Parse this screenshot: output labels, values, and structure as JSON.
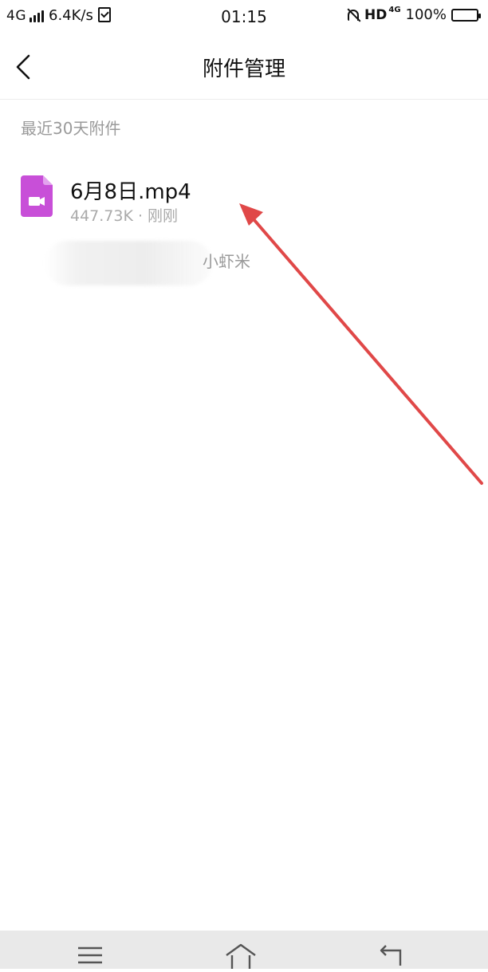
{
  "status_bar": {
    "network": "4G",
    "speed": "6.4K/s",
    "time": "01:15",
    "hd": "HD",
    "hd_network": "4G",
    "battery": "100%",
    "icons": [
      "signal-icon",
      "clipboard-check-icon",
      "bell-off-icon",
      "battery-icon"
    ]
  },
  "header": {
    "title": "附件管理",
    "back_icon": "chevron-left-icon"
  },
  "section": {
    "label": "最近30天附件"
  },
  "file": {
    "name": "6月8日.mp4",
    "meta": "447.73K · 刚刚",
    "icon": "video-file-icon",
    "icon_color": "#c84fd8"
  },
  "sender": {
    "name": "小虾米"
  },
  "annotation": {
    "color": "#e04848"
  },
  "navbar": {
    "icons": [
      "menu-icon",
      "home-icon",
      "back-icon"
    ]
  }
}
